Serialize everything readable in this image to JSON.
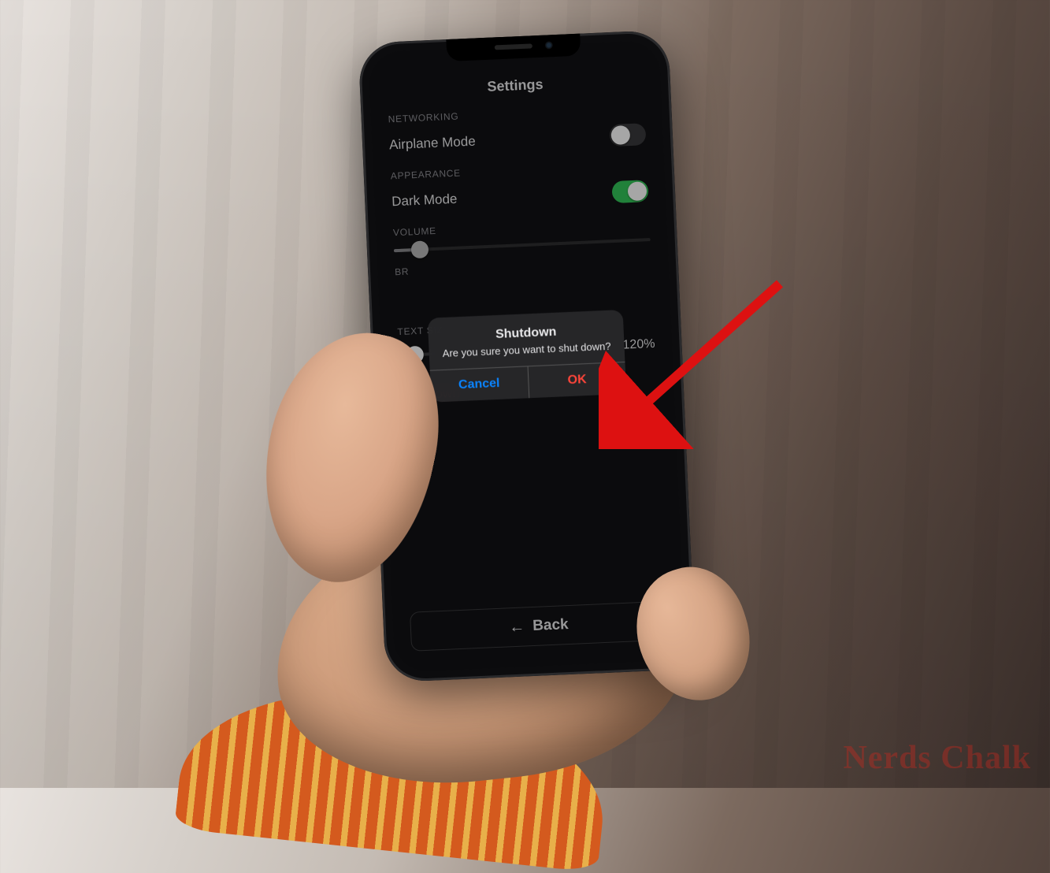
{
  "screen": {
    "title": "Settings",
    "sections": {
      "networking": {
        "label": "NETWORKING",
        "airplane_mode": {
          "label": "Airplane Mode",
          "on": false
        }
      },
      "appearance": {
        "label": "APPEARANCE",
        "dark_mode": {
          "label": "Dark Mode",
          "on": true
        }
      },
      "volume": {
        "label": "VOLUME"
      },
      "brightness": {
        "label_prefix": "BR"
      },
      "text_size": {
        "label": "TEXT SIZE",
        "value_display": "120%",
        "slider_pct": 8
      }
    },
    "shutdown_link": "Shutdown",
    "back_button": "Back"
  },
  "alert": {
    "title": "Shutdown",
    "message": "Are you sure you want to shut down?",
    "cancel": "Cancel",
    "ok": "OK"
  },
  "watermark": "Nerds Chalk",
  "colors": {
    "accent_blue": "#0a84ff",
    "destructive_red": "#ff453a",
    "toggle_green": "#34c759"
  }
}
